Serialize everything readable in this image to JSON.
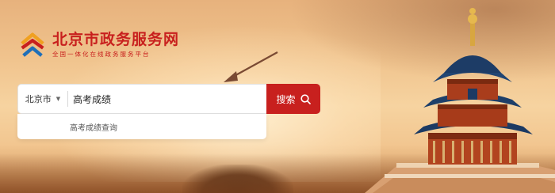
{
  "logo": {
    "title": "北京市政务服务网",
    "subtitle": "全国一体化在线政务服务平台"
  },
  "search": {
    "city_label": "北京市",
    "value": "高考成绩",
    "button_label": "搜索"
  },
  "suggestions": [
    {
      "label": "高考成绩查询"
    }
  ],
  "colors": {
    "brand_red": "#c8201e",
    "logo_blue": "#1f6fb8",
    "logo_orange": "#f0a020"
  }
}
